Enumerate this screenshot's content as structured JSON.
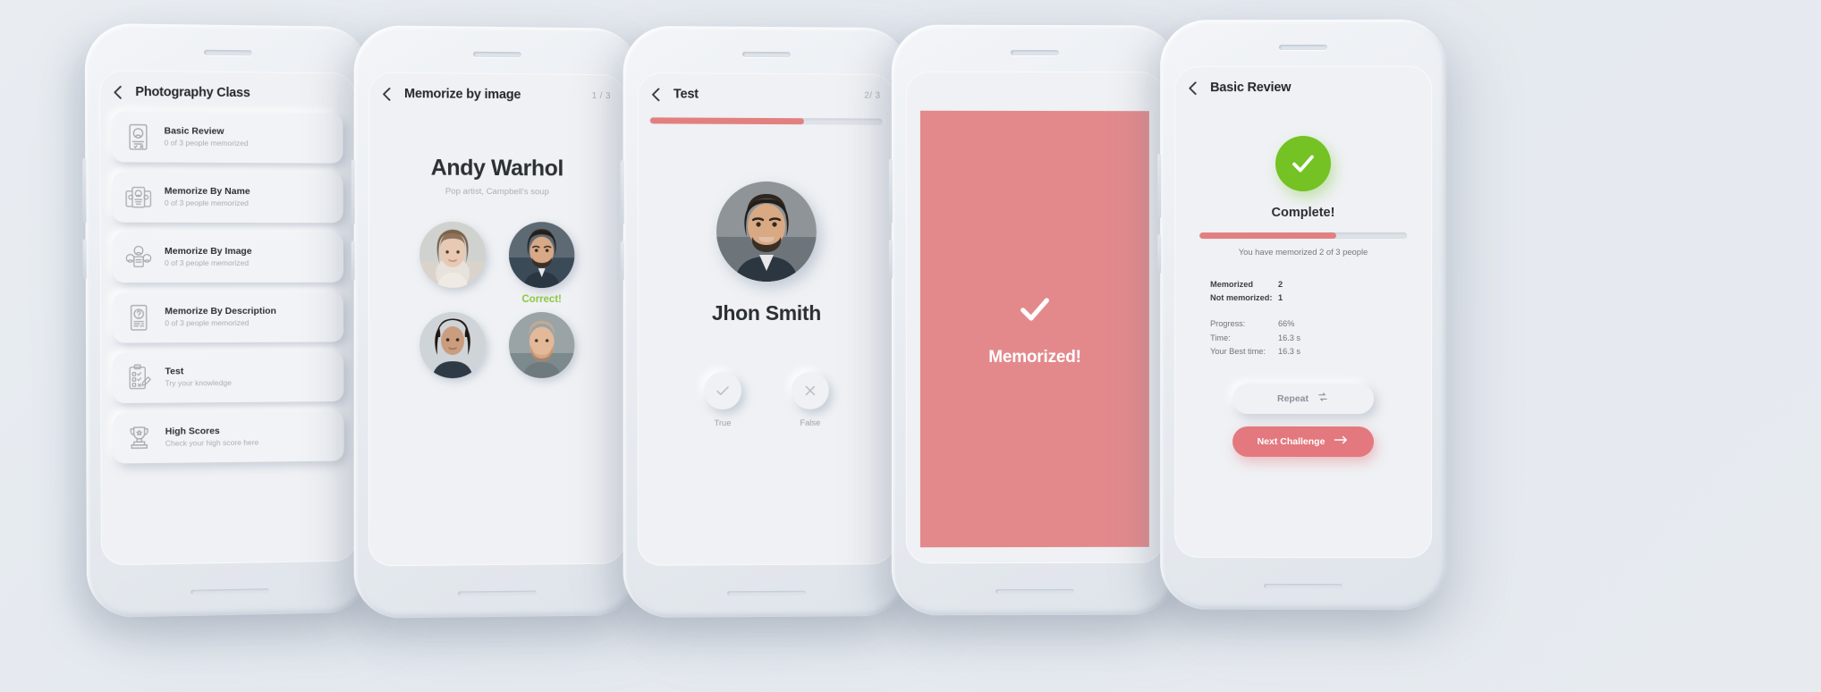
{
  "phones": [
    {
      "id": "photography-class",
      "nav": {
        "title": "Photography Class",
        "count": ""
      },
      "menu_items": [
        {
          "title": "Basic Review",
          "sub": "0 of 3 people memorized",
          "icon": "id-card-icon"
        },
        {
          "title": "Memorize By Name",
          "sub": "0 of 3 people memorized",
          "icon": "cards-stack-icon"
        },
        {
          "title": "Memorize By Image",
          "sub": "0 of 3 people memorized",
          "icon": "people-group-icon"
        },
        {
          "title": "Memorize By Description",
          "sub": "0 of 3 people memorized",
          "icon": "question-card-icon"
        },
        {
          "title": "Test",
          "sub": "Try your knowledge",
          "icon": "clipboard-pencil-icon"
        },
        {
          "title": "High Scores",
          "sub": "Check your high score here",
          "icon": "trophy-icon"
        }
      ]
    },
    {
      "id": "memorize-by-image",
      "nav": {
        "title": "Memorize by image",
        "count": "1 / 3"
      },
      "person": {
        "name": "Andy Warhol",
        "description": "Pop artist, Campbell's soup"
      },
      "feedback": {
        "label": "Correct!",
        "color": "#8cc63e"
      },
      "choices": [
        {
          "name": "choice-1",
          "correct": false
        },
        {
          "name": "choice-2",
          "correct": true
        },
        {
          "name": "choice-3",
          "correct": false
        },
        {
          "name": "choice-4",
          "correct": false
        }
      ]
    },
    {
      "id": "test",
      "nav": {
        "title": "Test",
        "count": "2/ 3"
      },
      "progress_percent": 66,
      "person": {
        "name": "Jhon Smith"
      },
      "answers": [
        {
          "label": "True",
          "icon": "check-icon"
        },
        {
          "label": "False",
          "icon": "close-icon"
        }
      ]
    },
    {
      "id": "memorized",
      "overlay": {
        "text": "Memorized!",
        "icon": "check-icon",
        "color": "#e3898c"
      }
    },
    {
      "id": "basic-review-complete",
      "nav": {
        "title": "Basic Review",
        "count": ""
      },
      "badge": {
        "icon": "check-circle-icon",
        "color": "#74c224"
      },
      "title": "Complete!",
      "progress_percent": 66,
      "summary": "You have memorized 2 of 3 people",
      "counts": [
        {
          "key": "Memorized",
          "value": "2"
        },
        {
          "key": "Not memorized:",
          "value": "1"
        }
      ],
      "stats": [
        {
          "key": "Progress:",
          "value": "66%"
        },
        {
          "key": "Time:",
          "value": "16.3 s"
        },
        {
          "key": "Your Best time:",
          "value": "16.3 s"
        }
      ],
      "buttons": {
        "repeat": {
          "label": "Repeat",
          "icon": "refresh-icon"
        },
        "next": {
          "label": "Next Challenge",
          "icon": "arrow-right-icon",
          "color": "#e3787e"
        }
      }
    }
  ]
}
